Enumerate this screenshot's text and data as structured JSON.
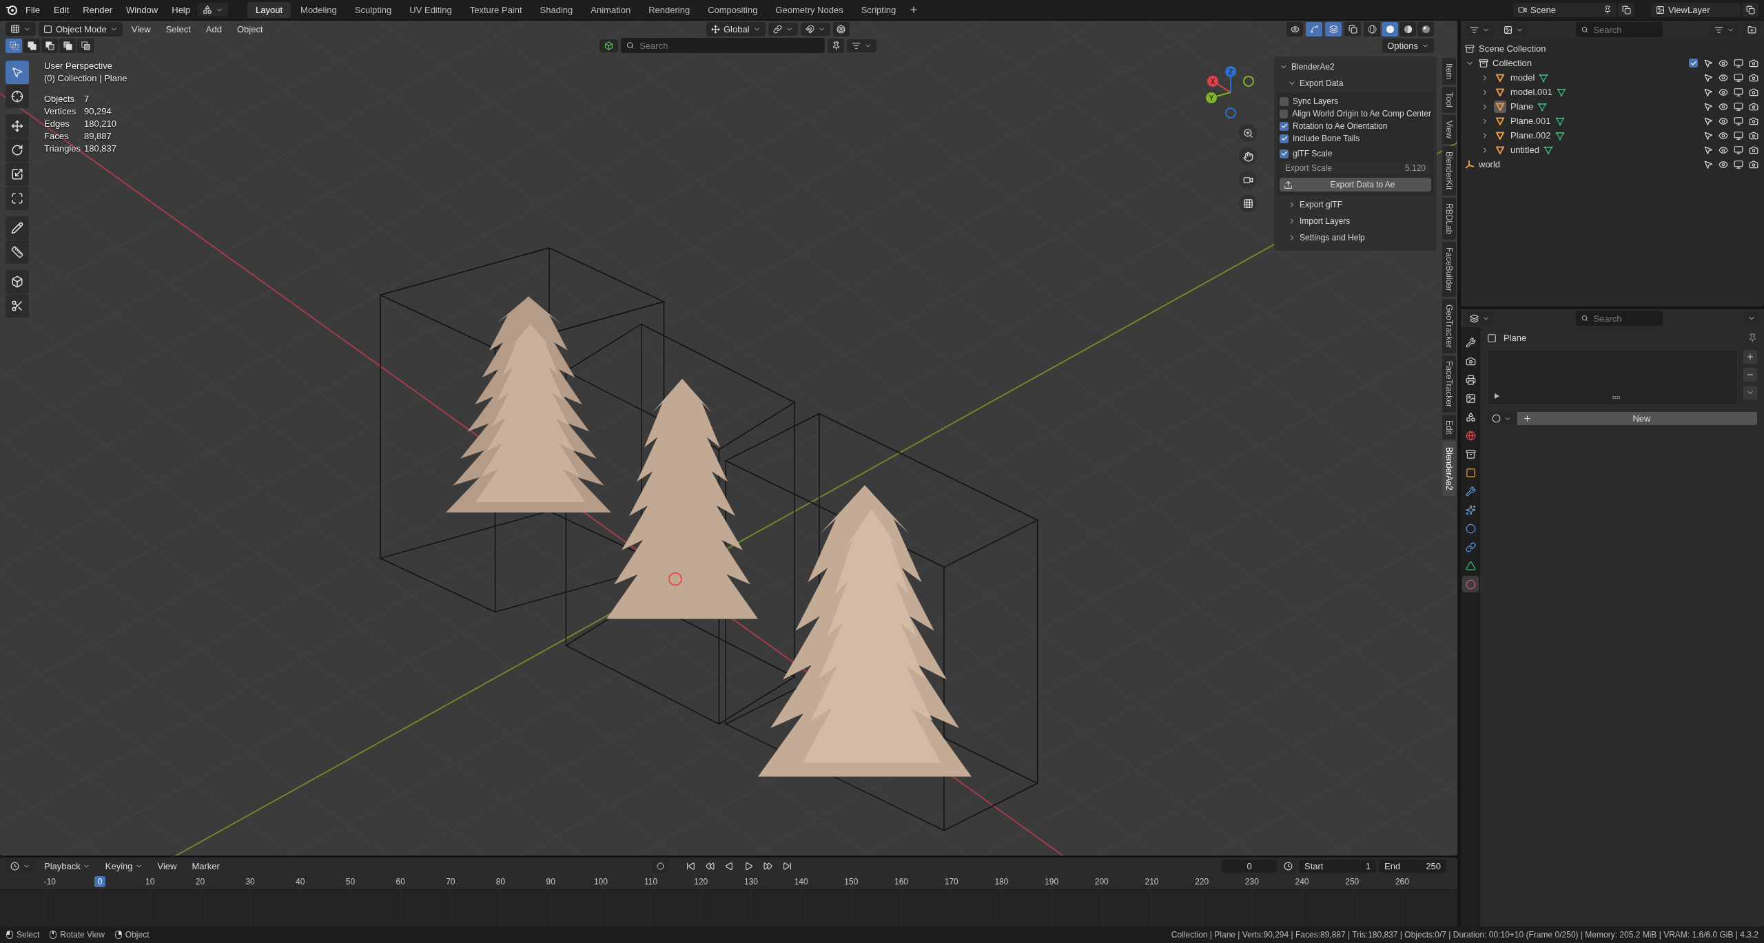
{
  "top_menu": [
    "File",
    "Edit",
    "Render",
    "Window",
    "Help"
  ],
  "workspaces": [
    {
      "label": "Layout",
      "selected": true
    },
    {
      "label": "Modeling",
      "selected": false
    },
    {
      "label": "Sculpting",
      "selected": false
    },
    {
      "label": "UV Editing",
      "selected": false
    },
    {
      "label": "Texture Paint",
      "selected": false
    },
    {
      "label": "Shading",
      "selected": false
    },
    {
      "label": "Animation",
      "selected": false
    },
    {
      "label": "Rendering",
      "selected": false
    },
    {
      "label": "Compositing",
      "selected": false
    },
    {
      "label": "Geometry Nodes",
      "selected": false
    },
    {
      "label": "Scripting",
      "selected": false
    }
  ],
  "scene_selector": "Scene",
  "view_layer_selector": "ViewLayer",
  "viewport": {
    "mode": "Object Mode",
    "menus": [
      "View",
      "Select",
      "Add",
      "Object"
    ],
    "orientation": "Global",
    "header_toggles": [
      {
        "kind": "visibility",
        "selected": false
      },
      {
        "kind": "gizmos",
        "selected": true
      },
      {
        "kind": "overlays",
        "selected": true
      },
      {
        "kind": "xray",
        "selected": false
      }
    ],
    "shading": [
      {
        "kind": "wireframe",
        "selected": false
      },
      {
        "kind": "solid",
        "selected": true
      },
      {
        "kind": "material",
        "selected": false
      },
      {
        "kind": "rendered",
        "selected": false
      }
    ],
    "select_modes": [
      {
        "kind": "new",
        "selected": true
      },
      {
        "kind": "extend",
        "selected": false
      },
      {
        "kind": "subtract",
        "selected": false
      },
      {
        "kind": "invert",
        "selected": false
      },
      {
        "kind": "intersect",
        "selected": false
      }
    ],
    "search": {
      "placeholder": "Search"
    },
    "options_label": "Options",
    "tools": [
      {
        "kind": "select",
        "selected": true
      },
      {
        "kind": "cursor",
        "selected": false
      },
      {
        "kind": "move",
        "selected": false
      },
      {
        "kind": "rotate",
        "selected": false
      },
      {
        "kind": "scale",
        "selected": false
      },
      {
        "kind": "transform",
        "selected": false
      },
      {
        "kind": "annotate",
        "selected": false
      },
      {
        "kind": "measure",
        "selected": false
      },
      {
        "kind": "add-cube",
        "selected": false
      },
      {
        "kind": "cut",
        "selected": false
      }
    ],
    "overlay": {
      "title": "User Perspective",
      "context": "(0) Collection | Plane",
      "stats": [
        {
          "label": "Objects",
          "value": "7"
        },
        {
          "label": "Vertices",
          "value": "90,294"
        },
        {
          "label": "Edges",
          "value": "180,210"
        },
        {
          "label": "Faces",
          "value": "89,887"
        },
        {
          "label": "Triangles",
          "value": "180,837"
        }
      ]
    },
    "gizmo": [
      {
        "label": "Z",
        "color": "#2f6fd0"
      },
      {
        "label": "X",
        "color": "#e0414f"
      },
      {
        "label": "Y",
        "color": "#7fb62a"
      }
    ],
    "sidebar_tabs": [
      {
        "label": "Item",
        "selected": false
      },
      {
        "label": "Tool",
        "selected": false
      },
      {
        "label": "View",
        "selected": false
      },
      {
        "label": "BlenderKit",
        "selected": false
      },
      {
        "label": "RBDLab",
        "selected": false
      },
      {
        "label": "FaceBuilder",
        "selected": false
      },
      {
        "label": "GeoTracker",
        "selected": false
      },
      {
        "label": "FaceTracker",
        "selected": false
      },
      {
        "label": "Edit",
        "selected": false
      },
      {
        "label": "BlenderAe2",
        "selected": true
      }
    ],
    "addon_panel": {
      "title": "BlenderAe2",
      "expanded": true,
      "subpanel": {
        "label": "Export Data",
        "expanded": true,
        "options": [
          {
            "label": "Sync Layers",
            "checked": false
          },
          {
            "label": "Align World Origin to Ae Comp Center",
            "checked": false
          },
          {
            "label": "Rotation to Ae Orientation",
            "checked": true
          },
          {
            "label": "Include Bone Tails",
            "checked": true
          }
        ],
        "scale_toggle": {
          "label": "glTF Scale",
          "checked": true
        },
        "scale_field": {
          "label": "Export Scale",
          "value": "5.120",
          "disabled": true
        },
        "button": "Export Data to Ae"
      },
      "sections": [
        {
          "label": "Export glTF",
          "expanded": false
        },
        {
          "label": "Import Layers",
          "expanded": false
        },
        {
          "label": "Settings and Help",
          "expanded": false
        }
      ]
    }
  },
  "outliner": {
    "search": {
      "placeholder": "Search"
    },
    "tree": [
      {
        "label": "Scene Collection",
        "kind": "scene",
        "children": [
          {
            "label": "Collection",
            "kind": "collection",
            "expanded": true,
            "checked": true,
            "children": [
              {
                "label": "model",
                "kind": "mesh",
                "expanded": false,
                "active": false
              },
              {
                "label": "model.001",
                "kind": "mesh",
                "expanded": false,
                "active": false
              },
              {
                "label": "Plane",
                "kind": "mesh",
                "expanded": false,
                "active": true
              },
              {
                "label": "Plane.001",
                "kind": "mesh",
                "expanded": false,
                "active": false
              },
              {
                "label": "Plane.002",
                "kind": "mesh",
                "expanded": false,
                "active": false
              },
              {
                "label": "untitled",
                "kind": "mesh",
                "expanded": false,
                "active": false
              }
            ]
          },
          {
            "label": "world",
            "kind": "empty"
          }
        ]
      }
    ]
  },
  "properties": {
    "search": {
      "placeholder": "Search"
    },
    "tabs": [
      {
        "kind": "tool",
        "selected": false
      },
      {
        "kind": "render",
        "selected": false
      },
      {
        "kind": "output",
        "selected": false
      },
      {
        "kind": "view-layer",
        "selected": false
      },
      {
        "kind": "scene",
        "selected": false
      },
      {
        "kind": "world",
        "selected": false
      },
      {
        "kind": "collection",
        "selected": false
      },
      {
        "kind": "object",
        "selected": false
      },
      {
        "kind": "modifiers",
        "selected": false
      },
      {
        "kind": "particles",
        "selected": false
      },
      {
        "kind": "physics",
        "selected": false
      },
      {
        "kind": "constraints",
        "selected": false
      },
      {
        "kind": "data",
        "selected": false
      },
      {
        "kind": "material",
        "selected": true
      }
    ],
    "object": "Plane",
    "new_button": "New"
  },
  "timeline": {
    "menus": [
      {
        "label": "Playback",
        "kind": "dropdown"
      },
      {
        "label": "Keying",
        "kind": "dropdown"
      },
      {
        "label": "View",
        "kind": "plain"
      },
      {
        "label": "Marker",
        "kind": "plain"
      }
    ],
    "current_frame": "0",
    "start": {
      "label": "Start",
      "value": "1"
    },
    "end": {
      "label": "End",
      "value": "250"
    },
    "ticks": [
      {
        "label": "-10",
        "selected": false
      },
      {
        "label": "0",
        "selected": true
      },
      {
        "label": "10",
        "selected": false
      },
      {
        "label": "20",
        "selected": false
      },
      {
        "label": "30",
        "selected": false
      },
      {
        "label": "40",
        "selected": false
      },
      {
        "label": "50",
        "selected": false
      },
      {
        "label": "60",
        "selected": false
      },
      {
        "label": "70",
        "selected": false
      },
      {
        "label": "80",
        "selected": false
      },
      {
        "label": "90",
        "selected": false
      },
      {
        "label": "100",
        "selected": false
      },
      {
        "label": "110",
        "selected": false
      },
      {
        "label": "120",
        "selected": false
      },
      {
        "label": "130",
        "selected": false
      },
      {
        "label": "140",
        "selected": false
      },
      {
        "label": "150",
        "selected": false
      },
      {
        "label": "160",
        "selected": false
      },
      {
        "label": "170",
        "selected": false
      },
      {
        "label": "180",
        "selected": false
      },
      {
        "label": "190",
        "selected": false
      },
      {
        "label": "200",
        "selected": false
      },
      {
        "label": "210",
        "selected": false
      },
      {
        "label": "220",
        "selected": false
      },
      {
        "label": "230",
        "selected": false
      },
      {
        "label": "240",
        "selected": false
      },
      {
        "label": "250",
        "selected": false
      },
      {
        "label": "260",
        "selected": false
      }
    ]
  },
  "status_bar": {
    "hints": [
      {
        "label": "Select",
        "kind": "left"
      },
      {
        "label": "Rotate View",
        "kind": "middle"
      },
      {
        "label": "Object",
        "kind": "right"
      }
    ],
    "info": "Collection | Plane | Verts:90,294 | Faces:89,887 | Tris:180,837 | Objects:0/7 | Duration: 00:10+10 (Frame 0/250) | Memory: 205.2 MiB | VRAM: 1.6/6.0 GiB | 4.3.2"
  }
}
